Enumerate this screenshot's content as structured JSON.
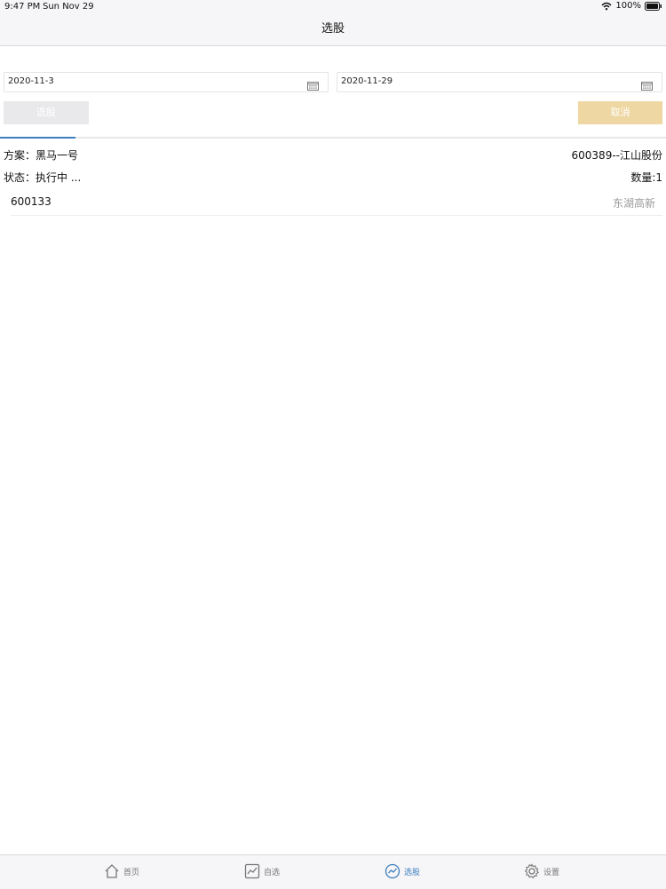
{
  "status_bar": {
    "time": "9:47 PM",
    "date": "Sun Nov 29",
    "battery": "100%"
  },
  "nav": {
    "title": "选股"
  },
  "filters": {
    "start_date": "2020-11-3",
    "end_date": "2020-11-29"
  },
  "actions": {
    "select_label": "选股",
    "cancel_label": "取消"
  },
  "progress": {
    "fraction": 0.113
  },
  "info": {
    "plan": "方案：黑马一号",
    "target": "600389--江山股份",
    "status": "状态：执行中 ...",
    "count": "数量:1"
  },
  "results": [
    {
      "code": "600133",
      "name": "东湖高新"
    }
  ],
  "tabs": [
    {
      "label": "首页",
      "icon": "home-icon"
    },
    {
      "label": "自选",
      "icon": "chart-icon"
    },
    {
      "label": "选股",
      "icon": "trend-icon"
    },
    {
      "label": "设置",
      "icon": "gear-icon"
    }
  ],
  "colors": {
    "accent": "#3d7fbf",
    "cancel_button": "#eed7a2",
    "disabled_button": "#e9e9eb"
  }
}
